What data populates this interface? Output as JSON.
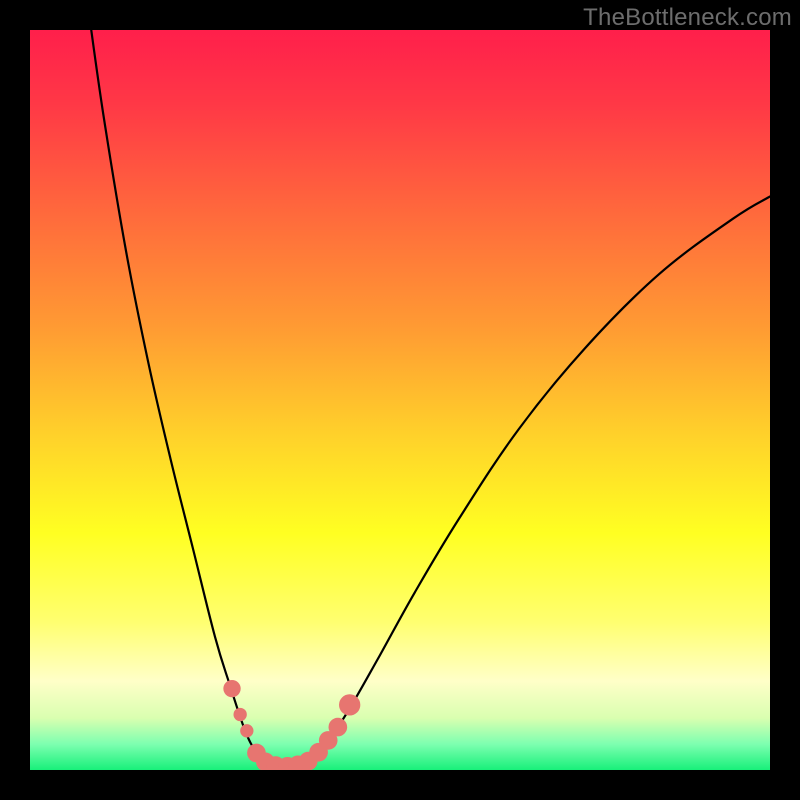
{
  "watermark": "TheBottleneck.com",
  "chart_data": {
    "type": "line",
    "title": "",
    "xlabel": "",
    "ylabel": "",
    "xlim": [
      0,
      100
    ],
    "ylim": [
      0,
      100
    ],
    "background_gradient": {
      "stops": [
        {
          "offset": 0.0,
          "color": "#ff1f4b"
        },
        {
          "offset": 0.1,
          "color": "#ff3846"
        },
        {
          "offset": 0.25,
          "color": "#ff6a3c"
        },
        {
          "offset": 0.4,
          "color": "#ff9a33"
        },
        {
          "offset": 0.55,
          "color": "#ffd22a"
        },
        {
          "offset": 0.68,
          "color": "#ffff22"
        },
        {
          "offset": 0.8,
          "color": "#ffff70"
        },
        {
          "offset": 0.88,
          "color": "#ffffc8"
        },
        {
          "offset": 0.93,
          "color": "#d9ffb0"
        },
        {
          "offset": 0.965,
          "color": "#7dffb0"
        },
        {
          "offset": 1.0,
          "color": "#18f07a"
        }
      ]
    },
    "series": [
      {
        "name": "bottleneck-curve",
        "stroke": "#000000",
        "stroke_width": 2.2,
        "points": [
          {
            "x": 8.0,
            "y": 102.0
          },
          {
            "x": 10.0,
            "y": 88.0
          },
          {
            "x": 13.0,
            "y": 70.0
          },
          {
            "x": 16.0,
            "y": 55.0
          },
          {
            "x": 19.0,
            "y": 42.0
          },
          {
            "x": 22.0,
            "y": 30.0
          },
          {
            "x": 25.0,
            "y": 18.0
          },
          {
            "x": 27.0,
            "y": 11.5
          },
          {
            "x": 29.0,
            "y": 5.5
          },
          {
            "x": 30.5,
            "y": 2.5
          },
          {
            "x": 32.0,
            "y": 1.0
          },
          {
            "x": 34.0,
            "y": 0.5
          },
          {
            "x": 36.0,
            "y": 0.6
          },
          {
            "x": 38.0,
            "y": 1.5
          },
          {
            "x": 40.0,
            "y": 3.5
          },
          {
            "x": 43.0,
            "y": 8.0
          },
          {
            "x": 47.0,
            "y": 15.0
          },
          {
            "x": 52.0,
            "y": 24.0
          },
          {
            "x": 58.0,
            "y": 34.0
          },
          {
            "x": 66.0,
            "y": 46.0
          },
          {
            "x": 75.0,
            "y": 57.0
          },
          {
            "x": 85.0,
            "y": 67.0
          },
          {
            "x": 95.0,
            "y": 74.5
          },
          {
            "x": 100.0,
            "y": 77.5
          }
        ]
      }
    ],
    "markers": [
      {
        "x": 27.3,
        "y": 11.0,
        "r": 1.3,
        "color": "#e77570"
      },
      {
        "x": 28.4,
        "y": 7.5,
        "r": 1.0,
        "color": "#e77570"
      },
      {
        "x": 29.3,
        "y": 5.3,
        "r": 1.0,
        "color": "#e77570"
      },
      {
        "x": 30.6,
        "y": 2.3,
        "r": 1.4,
        "color": "#e77570"
      },
      {
        "x": 31.8,
        "y": 1.1,
        "r": 1.4,
        "color": "#e77570"
      },
      {
        "x": 33.2,
        "y": 0.6,
        "r": 1.4,
        "color": "#e77570"
      },
      {
        "x": 34.8,
        "y": 0.5,
        "r": 1.4,
        "color": "#e77570"
      },
      {
        "x": 36.2,
        "y": 0.7,
        "r": 1.4,
        "color": "#e77570"
      },
      {
        "x": 37.6,
        "y": 1.2,
        "r": 1.4,
        "color": "#e77570"
      },
      {
        "x": 39.0,
        "y": 2.4,
        "r": 1.4,
        "color": "#e77570"
      },
      {
        "x": 40.3,
        "y": 4.0,
        "r": 1.4,
        "color": "#e77570"
      },
      {
        "x": 41.6,
        "y": 5.8,
        "r": 1.4,
        "color": "#e77570"
      },
      {
        "x": 43.2,
        "y": 8.8,
        "r": 1.6,
        "color": "#e77570"
      }
    ]
  }
}
